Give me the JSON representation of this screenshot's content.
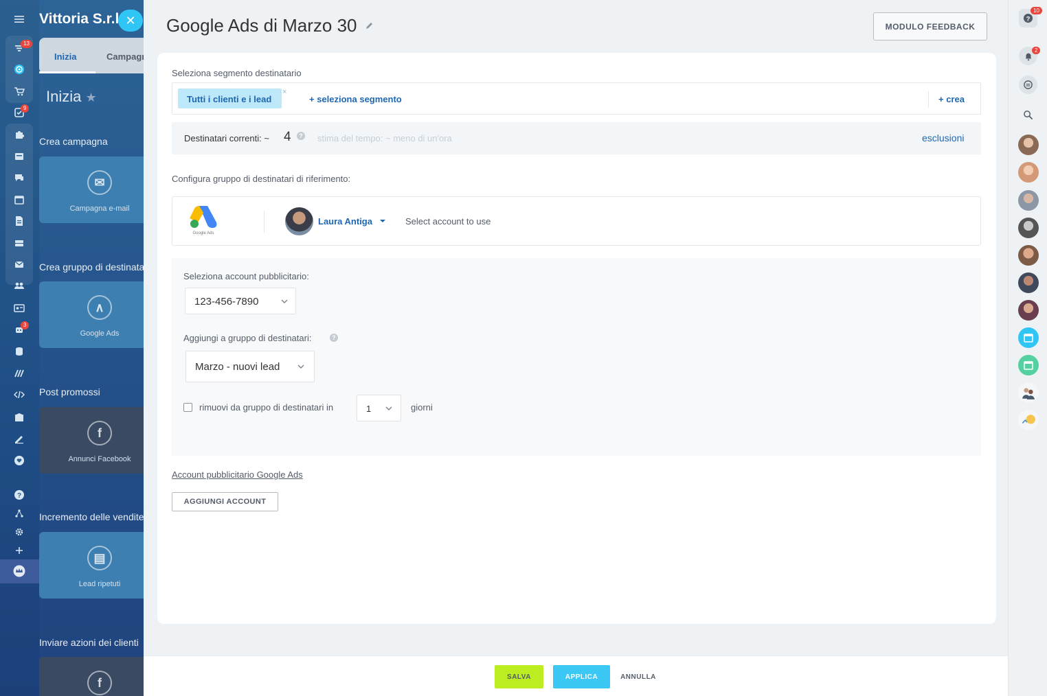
{
  "colors": {
    "accent_blue": "#2067b0",
    "save_green": "#bbed21",
    "apply_cyan": "#3bc8f5",
    "rail_blue": "#1f4f86"
  },
  "rail": {
    "icons": [
      "menu-icon",
      "filter-icon",
      "target-icon",
      "cart-icon",
      "checklist-icon",
      "puzzle-icon",
      "card-icon",
      "chat-icon",
      "calendar-icon",
      "document-icon",
      "drive-icon",
      "mail-icon",
      "contacts-icon",
      "id-card-icon",
      "robot-icon",
      "database-icon",
      "marketing-icon",
      "code-icon",
      "building-icon",
      "sign-icon",
      "heart-icon",
      "help-icon",
      "sitemap-icon",
      "settings-icon",
      "plus-icon",
      "crown-icon"
    ],
    "badges": {
      "filter": "13",
      "checklist": "9",
      "robot": "3"
    }
  },
  "background": {
    "company": "Vittoria S.r.l",
    "tabs": [
      "Inizia",
      "Campagne"
    ],
    "heading": "Inizia",
    "sections": [
      {
        "title": "Crea campagna",
        "card": "Campagna e-mail",
        "icon": "email-icon"
      },
      {
        "title": "Crea gruppo di destinatari",
        "card": "Google Ads",
        "icon": "google-ads-icon"
      },
      {
        "title": "Post promossi",
        "card": "Annunci Facebook",
        "icon": "facebook-icon"
      },
      {
        "title": "Incremento delle vendite",
        "card": "Lead ripetuti",
        "icon": "lead-icon"
      },
      {
        "title": "Inviare azioni dei clienti",
        "card": "",
        "icon": "facebook-icon"
      }
    ]
  },
  "slider": {
    "title": "Google Ads di Marzo 30",
    "feedback_button": "MODULO FEEDBACK",
    "segment": {
      "label": "Seleziona segmento destinatario",
      "chip": "Tutti i clienti e i lead",
      "chip_remove": "×",
      "add_segment": "+ seleziona segmento",
      "create": "+ crea"
    },
    "recipients": {
      "label": "Destinatari correnti: ~",
      "count": "4",
      "estimate": "stima del tempo: ~ meno di un'ora",
      "exclusions": "esclusioni"
    },
    "configure_label": "Configura gruppo di destinatari di riferimento:",
    "ads_card": {
      "logo_caption": "Google Ads",
      "user_name": "Laura Antiga",
      "select_account": "Select account to use"
    },
    "ad_account": {
      "label": "Seleziona account pubblicitario:",
      "value": "123-456-7890"
    },
    "audience": {
      "label": "Aggiungi a gruppo di destinatari:",
      "value": "Marzo - nuovi lead"
    },
    "remove": {
      "checked": false,
      "label": "rimuovi da gruppo di destinatari in",
      "days_value": "1",
      "days_unit": "giorni"
    },
    "account_link": "Account pubblicitario Google Ads",
    "add_account_button": "AGGIUNGI ACCOUNT",
    "footer": {
      "save": "SALVA",
      "apply": "APPLICA",
      "cancel": "ANNULLA"
    }
  },
  "right_bar": {
    "help_badge": "10",
    "notifications_badge": "2"
  }
}
